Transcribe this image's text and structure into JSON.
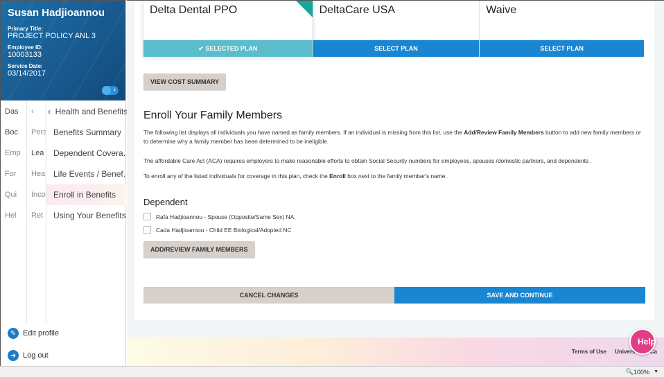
{
  "profile": {
    "name": "Susan Hadjioannou",
    "primary_title_label": "Primary Title:",
    "primary_title": "PROJECT POLICY ANL 3",
    "employee_id_label": "Employee ID:",
    "employee_id": "10003133",
    "service_date_label": "Service Date:",
    "service_date": "03/14/2017"
  },
  "nav": {
    "col1": [
      "Das",
      "Boc",
      "Emp",
      "For",
      "Qui",
      "Hel"
    ],
    "col2": [
      "Pers",
      "Lea",
      "Hea",
      "Inco",
      "Ret"
    ],
    "header": "Health and Benefits",
    "items": [
      {
        "label": "Benefits Summary"
      },
      {
        "label": "Dependent Covera..."
      },
      {
        "label": "Life Events / Benef..."
      },
      {
        "label": "Enroll in Benefits"
      },
      {
        "label": "Using Your Benefits"
      }
    ]
  },
  "bottom": {
    "edit_profile": "Edit profile",
    "log_out": "Log out"
  },
  "plans": [
    {
      "name": "Delta Dental PPO",
      "button": "SELECTED PLAN",
      "selected": true
    },
    {
      "name": "DeltaCare USA",
      "button": "SELECT PLAN",
      "selected": false
    },
    {
      "name": "Waive",
      "button": "SELECT PLAN",
      "selected": false
    }
  ],
  "view_cost_summary": "VIEW COST SUMMARY",
  "enroll": {
    "title": "Enroll Your Family Members",
    "p1_a": "The following list displays all individuals you have named as family members. If an individual is missing from this list, use the ",
    "p1_bold": "Add/Review Family Members",
    "p1_b": " button to add new family members or to determine why a family member has been determined to be ineligible.",
    "p2": "The affordable Care Act (ACA) requires employers to make reasonable efforts to obtain Social Security numbers for employees, spouses /domestic partners, and dependents .",
    "p3_a": "To enroll any of the listed individuals for coverage in this plan, check the ",
    "p3_bold": "Enroll",
    "p3_b": " box next to the family member's name."
  },
  "dependents": {
    "title": "Dependent",
    "items": [
      "Rafa Hadjioannou - Spouse (Opposite/Same Sex) NA",
      "Cada Hadjioannou - Child EE Biological/Adopted NC"
    ],
    "add_button": "ADD/REVIEW FAMILY MEMBERS"
  },
  "actions": {
    "cancel": "CANCEL CHANGES",
    "save": "SAVE AND CONTINUE"
  },
  "footer": {
    "terms": "Terms of Use",
    "university": "University of Ca"
  },
  "help": "Help",
  "zoom": "100%",
  "colors": {
    "primary_blue": "#1a86d2",
    "selected_teal": "#5bbccb",
    "help_pink": "#e33d88"
  }
}
